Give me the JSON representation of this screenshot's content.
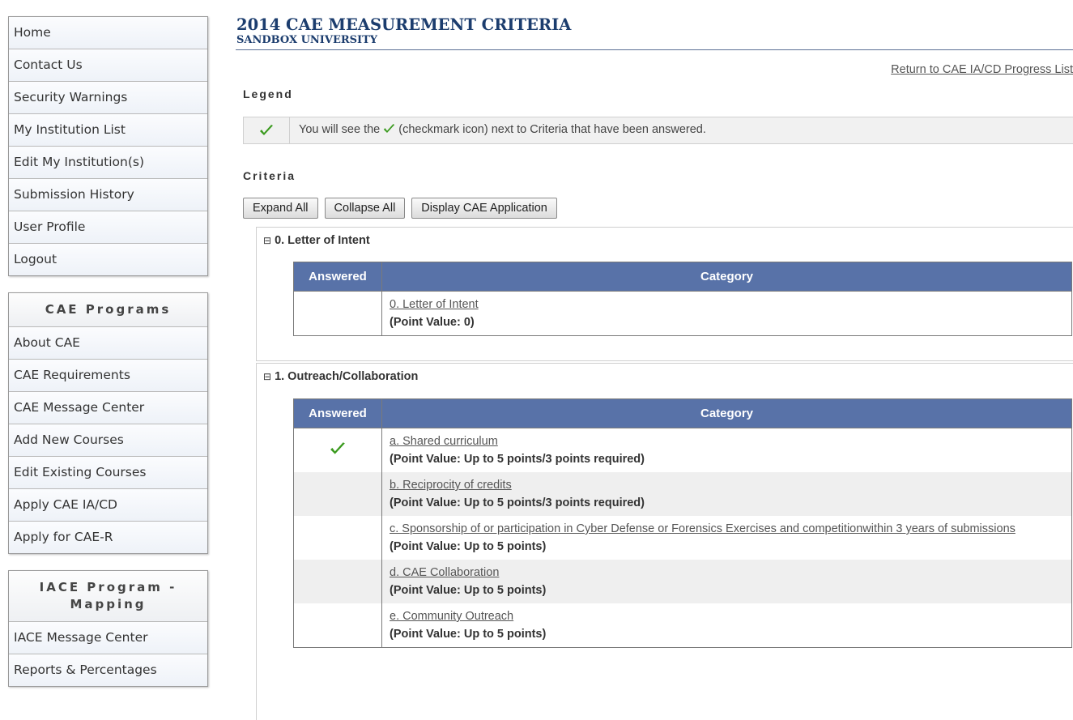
{
  "nav_main": [
    "Home",
    "Contact Us",
    "Security Warnings",
    "My Institution List",
    "Edit My Institution(s)",
    "Submission History",
    "User Profile",
    "Logout"
  ],
  "cae_programs": {
    "header": "CAE Programs",
    "items": [
      "About CAE",
      "CAE Requirements",
      "CAE Message Center",
      "Add New Courses",
      "Edit Existing Courses",
      "Apply CAE IA/CD",
      "Apply for CAE-R"
    ]
  },
  "iace": {
    "header": "IACE Program - Mapping",
    "items": [
      "IACE Message Center",
      "Reports & Percentages"
    ]
  },
  "page": {
    "title": "2014 CAE MEASUREMENT CRITERIA",
    "subtitle": "SANDBOX UNIVERSITY",
    "return_link": "Return to CAE IA/CD Progress List"
  },
  "legend": {
    "label": "Legend",
    "text_before": "You will see the ",
    "text_after": " (checkmark icon) next to Criteria that have been answered."
  },
  "criteria": {
    "label": "Criteria",
    "buttons": [
      "Expand All",
      "Collapse All",
      "Display CAE Application"
    ],
    "table_headers": {
      "answered": "Answered",
      "category": "Category"
    },
    "sections": [
      {
        "toggle": "⊟",
        "title": "0. Letter of Intent",
        "rows": [
          {
            "answered": false,
            "link": "0. Letter of Intent",
            "points": "(Point Value: 0)"
          }
        ]
      },
      {
        "toggle": "⊟",
        "title": "1. Outreach/Collaboration",
        "rows": [
          {
            "answered": true,
            "link": "a. Shared curriculum",
            "points": "(Point Value: Up to 5 points/3 points required)"
          },
          {
            "answered": false,
            "link": "b. Reciprocity of credits",
            "points": "(Point Value: Up to 5 points/3 points required)"
          },
          {
            "answered": false,
            "link": "c. Sponsorship of or participation in Cyber Defense or Forensics Exercises and competitionwithin 3 years of submissions",
            "points": "(Point Value: Up to 5 points)"
          },
          {
            "answered": false,
            "link": "d. CAE Collaboration",
            "points": "(Point Value: Up to 5 points)"
          },
          {
            "answered": false,
            "link": "e. Community Outreach",
            "points": "(Point Value: Up to 5 points)"
          }
        ]
      }
    ]
  },
  "icons": {
    "answered": "checkmark-icon",
    "section_toggle": "collapse-toggle-icon"
  },
  "colors": {
    "title": "#1c3d6e",
    "table_header": "#5872a8",
    "check": "#3a9a1e",
    "alt_row": "#efefef"
  }
}
